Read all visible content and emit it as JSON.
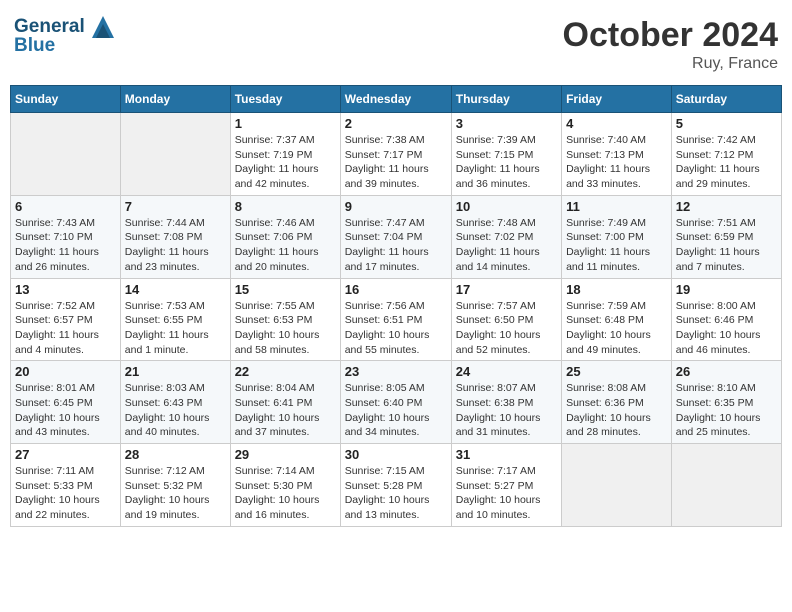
{
  "header": {
    "logo_line1": "General",
    "logo_line2": "Blue",
    "month": "October 2024",
    "location": "Ruy, France"
  },
  "days_of_week": [
    "Sunday",
    "Monday",
    "Tuesday",
    "Wednesday",
    "Thursday",
    "Friday",
    "Saturday"
  ],
  "weeks": [
    [
      {
        "day": "",
        "sunrise": "",
        "sunset": "",
        "daylight": ""
      },
      {
        "day": "",
        "sunrise": "",
        "sunset": "",
        "daylight": ""
      },
      {
        "day": "1",
        "sunrise": "Sunrise: 7:37 AM",
        "sunset": "Sunset: 7:19 PM",
        "daylight": "Daylight: 11 hours and 42 minutes."
      },
      {
        "day": "2",
        "sunrise": "Sunrise: 7:38 AM",
        "sunset": "Sunset: 7:17 PM",
        "daylight": "Daylight: 11 hours and 39 minutes."
      },
      {
        "day": "3",
        "sunrise": "Sunrise: 7:39 AM",
        "sunset": "Sunset: 7:15 PM",
        "daylight": "Daylight: 11 hours and 36 minutes."
      },
      {
        "day": "4",
        "sunrise": "Sunrise: 7:40 AM",
        "sunset": "Sunset: 7:13 PM",
        "daylight": "Daylight: 11 hours and 33 minutes."
      },
      {
        "day": "5",
        "sunrise": "Sunrise: 7:42 AM",
        "sunset": "Sunset: 7:12 PM",
        "daylight": "Daylight: 11 hours and 29 minutes."
      }
    ],
    [
      {
        "day": "6",
        "sunrise": "Sunrise: 7:43 AM",
        "sunset": "Sunset: 7:10 PM",
        "daylight": "Daylight: 11 hours and 26 minutes."
      },
      {
        "day": "7",
        "sunrise": "Sunrise: 7:44 AM",
        "sunset": "Sunset: 7:08 PM",
        "daylight": "Daylight: 11 hours and 23 minutes."
      },
      {
        "day": "8",
        "sunrise": "Sunrise: 7:46 AM",
        "sunset": "Sunset: 7:06 PM",
        "daylight": "Daylight: 11 hours and 20 minutes."
      },
      {
        "day": "9",
        "sunrise": "Sunrise: 7:47 AM",
        "sunset": "Sunset: 7:04 PM",
        "daylight": "Daylight: 11 hours and 17 minutes."
      },
      {
        "day": "10",
        "sunrise": "Sunrise: 7:48 AM",
        "sunset": "Sunset: 7:02 PM",
        "daylight": "Daylight: 11 hours and 14 minutes."
      },
      {
        "day": "11",
        "sunrise": "Sunrise: 7:49 AM",
        "sunset": "Sunset: 7:00 PM",
        "daylight": "Daylight: 11 hours and 11 minutes."
      },
      {
        "day": "12",
        "sunrise": "Sunrise: 7:51 AM",
        "sunset": "Sunset: 6:59 PM",
        "daylight": "Daylight: 11 hours and 7 minutes."
      }
    ],
    [
      {
        "day": "13",
        "sunrise": "Sunrise: 7:52 AM",
        "sunset": "Sunset: 6:57 PM",
        "daylight": "Daylight: 11 hours and 4 minutes."
      },
      {
        "day": "14",
        "sunrise": "Sunrise: 7:53 AM",
        "sunset": "Sunset: 6:55 PM",
        "daylight": "Daylight: 11 hours and 1 minute."
      },
      {
        "day": "15",
        "sunrise": "Sunrise: 7:55 AM",
        "sunset": "Sunset: 6:53 PM",
        "daylight": "Daylight: 10 hours and 58 minutes."
      },
      {
        "day": "16",
        "sunrise": "Sunrise: 7:56 AM",
        "sunset": "Sunset: 6:51 PM",
        "daylight": "Daylight: 10 hours and 55 minutes."
      },
      {
        "day": "17",
        "sunrise": "Sunrise: 7:57 AM",
        "sunset": "Sunset: 6:50 PM",
        "daylight": "Daylight: 10 hours and 52 minutes."
      },
      {
        "day": "18",
        "sunrise": "Sunrise: 7:59 AM",
        "sunset": "Sunset: 6:48 PM",
        "daylight": "Daylight: 10 hours and 49 minutes."
      },
      {
        "day": "19",
        "sunrise": "Sunrise: 8:00 AM",
        "sunset": "Sunset: 6:46 PM",
        "daylight": "Daylight: 10 hours and 46 minutes."
      }
    ],
    [
      {
        "day": "20",
        "sunrise": "Sunrise: 8:01 AM",
        "sunset": "Sunset: 6:45 PM",
        "daylight": "Daylight: 10 hours and 43 minutes."
      },
      {
        "day": "21",
        "sunrise": "Sunrise: 8:03 AM",
        "sunset": "Sunset: 6:43 PM",
        "daylight": "Daylight: 10 hours and 40 minutes."
      },
      {
        "day": "22",
        "sunrise": "Sunrise: 8:04 AM",
        "sunset": "Sunset: 6:41 PM",
        "daylight": "Daylight: 10 hours and 37 minutes."
      },
      {
        "day": "23",
        "sunrise": "Sunrise: 8:05 AM",
        "sunset": "Sunset: 6:40 PM",
        "daylight": "Daylight: 10 hours and 34 minutes."
      },
      {
        "day": "24",
        "sunrise": "Sunrise: 8:07 AM",
        "sunset": "Sunset: 6:38 PM",
        "daylight": "Daylight: 10 hours and 31 minutes."
      },
      {
        "day": "25",
        "sunrise": "Sunrise: 8:08 AM",
        "sunset": "Sunset: 6:36 PM",
        "daylight": "Daylight: 10 hours and 28 minutes."
      },
      {
        "day": "26",
        "sunrise": "Sunrise: 8:10 AM",
        "sunset": "Sunset: 6:35 PM",
        "daylight": "Daylight: 10 hours and 25 minutes."
      }
    ],
    [
      {
        "day": "27",
        "sunrise": "Sunrise: 7:11 AM",
        "sunset": "Sunset: 5:33 PM",
        "daylight": "Daylight: 10 hours and 22 minutes."
      },
      {
        "day": "28",
        "sunrise": "Sunrise: 7:12 AM",
        "sunset": "Sunset: 5:32 PM",
        "daylight": "Daylight: 10 hours and 19 minutes."
      },
      {
        "day": "29",
        "sunrise": "Sunrise: 7:14 AM",
        "sunset": "Sunset: 5:30 PM",
        "daylight": "Daylight: 10 hours and 16 minutes."
      },
      {
        "day": "30",
        "sunrise": "Sunrise: 7:15 AM",
        "sunset": "Sunset: 5:28 PM",
        "daylight": "Daylight: 10 hours and 13 minutes."
      },
      {
        "day": "31",
        "sunrise": "Sunrise: 7:17 AM",
        "sunset": "Sunset: 5:27 PM",
        "daylight": "Daylight: 10 hours and 10 minutes."
      },
      {
        "day": "",
        "sunrise": "",
        "sunset": "",
        "daylight": ""
      },
      {
        "day": "",
        "sunrise": "",
        "sunset": "",
        "daylight": ""
      }
    ]
  ]
}
